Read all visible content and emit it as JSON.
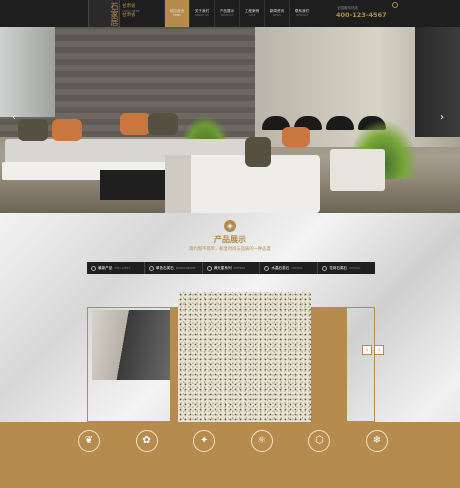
{
  "header": {
    "logo": "石家居",
    "brand_line1": "甘肃省",
    "brand_line2": "LOGO HERE",
    "brand_line3": "甘肃省",
    "nav": [
      {
        "label": "网站首页",
        "sub": "HOME"
      },
      {
        "label": "关于我们",
        "sub": "ABOUT US"
      },
      {
        "label": "产品展示",
        "sub": "PRODUCT"
      },
      {
        "label": "工程案例",
        "sub": "CASE"
      },
      {
        "label": "新闻资讯",
        "sub": "NEWS"
      },
      {
        "label": "联系我们",
        "sub": "CONTACT"
      }
    ],
    "phone_label": "全国服务热线",
    "phone": "400-123-4567"
  },
  "hero": {
    "prev": "‹",
    "next": "›"
  },
  "products": {
    "title": "产品展示",
    "subtitle": "简约而不简单，彰显时尚与品质的一种态度",
    "tabs": [
      {
        "label": "最新产品",
        "en": "THE LATEST"
      },
      {
        "label": "单色石英石",
        "en": "MONOCHROME"
      },
      {
        "label": "满天星系列",
        "en": "PATTERN"
      },
      {
        "label": "水晶石英石",
        "en": "CRYSTAL"
      },
      {
        "label": "花岗石英石",
        "en": "CRYSTAL"
      }
    ],
    "prev": "‹",
    "next": "›"
  },
  "feature_icons": [
    "leaf-icon",
    "palette-icon",
    "sparkle-icon",
    "molecule-icon",
    "hexagon-icon",
    "snowflake-icon"
  ],
  "feature_glyphs": [
    "❦",
    "✿",
    "✦",
    "⚛",
    "⬡",
    "❄"
  ],
  "colors": {
    "accent": "#b58c4e",
    "dark": "#1e1e1e"
  }
}
